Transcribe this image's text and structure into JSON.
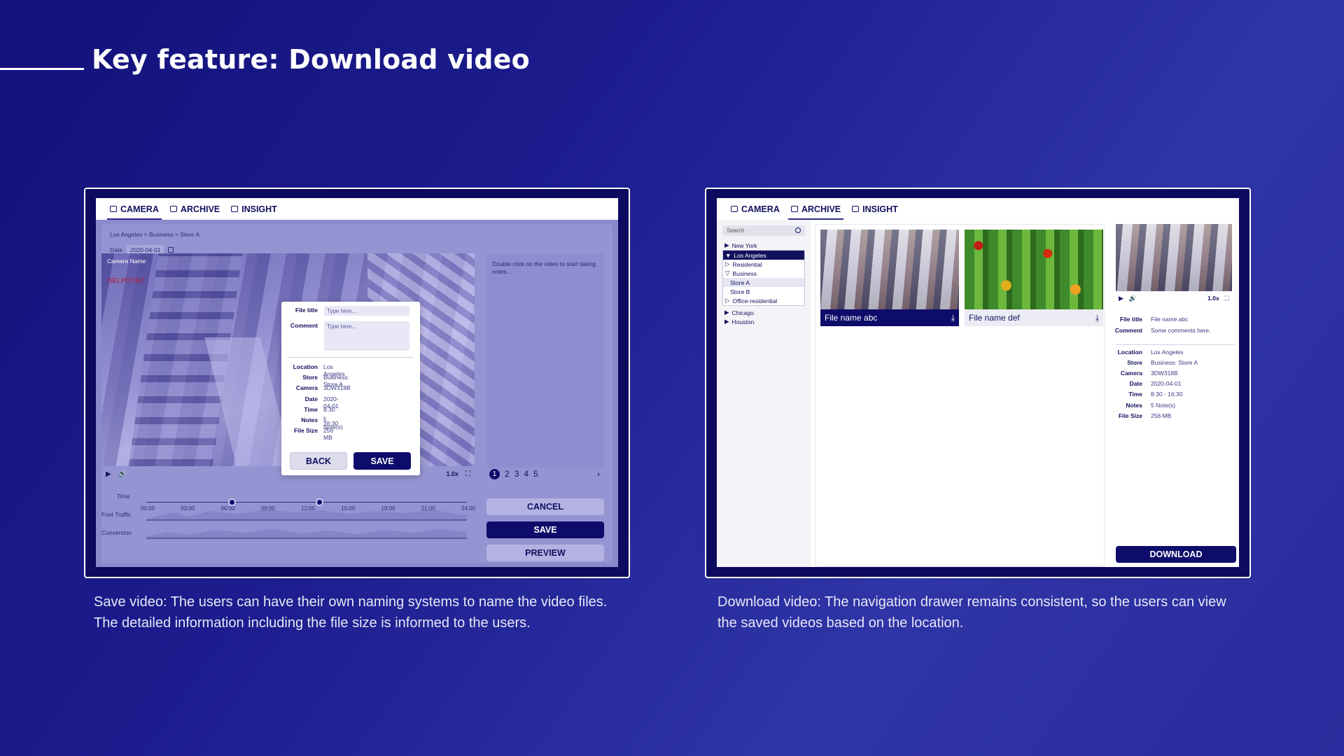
{
  "slide": {
    "title": "Key feature: Download video"
  },
  "tabs": [
    "CAMERA",
    "ARCHIVE",
    "INSIGHT"
  ],
  "left_screen": {
    "breadcrumb": "Los Angeles > Business > Store A",
    "date_label": "Date",
    "date_value": "2020-04-01",
    "camera_name": "Camera Name",
    "brand_text": "DELPOTEC",
    "notes_hint": "Double click on the video to start taking notes...",
    "dialog": {
      "file_title_label": "File title",
      "file_title_placeholder": "Type here...",
      "comment_label": "Comment",
      "comment_placeholder": "Type here...",
      "fields": [
        {
          "label": "Location",
          "value": "Los Angeles"
        },
        {
          "label": "Store",
          "value": "Business: Store A"
        },
        {
          "label": "Camera",
          "value": "3DW318B"
        },
        {
          "label": "Date",
          "value": "2020-04-01"
        },
        {
          "label": "Time",
          "value": "8:30 - 16:30"
        },
        {
          "label": "Notes",
          "value": "5 Note(s)"
        },
        {
          "label": "File Size",
          "value": "256 MB"
        }
      ],
      "back_label": "BACK",
      "save_label": "SAVE"
    },
    "speed": "1.0x",
    "pages": [
      "1",
      "2",
      "3",
      "4",
      "5"
    ],
    "pager_next": "›",
    "timeline": {
      "time_label": "Time",
      "ticks": [
        "00:00",
        "03:00",
        "06:00",
        "09:00",
        "12:00",
        "15:00",
        "18:00",
        "21:00",
        "24:00"
      ],
      "foot_traffic_label": "Foot Traffic",
      "conversion_label": "Conversion"
    },
    "cancel_label": "CANCEL",
    "save_label": "SAVE",
    "preview_label": "PREVIEW"
  },
  "right_screen": {
    "search_placeholder": "Search",
    "tree": {
      "new_york": "New York",
      "los_angeles": "Los Angeles",
      "residential": "Residential",
      "business": "Business",
      "store_a": "Store A",
      "store_b": "Store B",
      "office_residential": "Office-residential",
      "chicago": "Chicago",
      "houston": "Houston"
    },
    "files": [
      {
        "name": "File name abc"
      },
      {
        "name": "File name def"
      }
    ],
    "detail": {
      "speed": "1.0x",
      "fields": [
        {
          "label": "File title",
          "value": "File name abc"
        },
        {
          "label": "Comment",
          "value": "Some comments here."
        },
        {
          "label": "Location",
          "value": "Los Angeles"
        },
        {
          "label": "Store",
          "value": "Business: Store A"
        },
        {
          "label": "Camera",
          "value": "3DW318B"
        },
        {
          "label": "Date",
          "value": "2020-04-01"
        },
        {
          "label": "Time",
          "value": "8:30 - 16:30"
        },
        {
          "label": "Notes",
          "value": "5 Note(s)"
        },
        {
          "label": "File Size",
          "value": "256 MB"
        }
      ],
      "download_label": "DOWNLOAD"
    }
  },
  "captions": {
    "left": "Save video: The users can have their own naming systems to name the video files. The detailed information including the file size is informed to the users.",
    "right": "Download video: The navigation drawer remains consistent, so the users can view the saved videos based on the location."
  },
  "colors": {
    "navy": "#0e0c6a",
    "background": "#1c1c8e",
    "accent_text": "#12115e"
  }
}
